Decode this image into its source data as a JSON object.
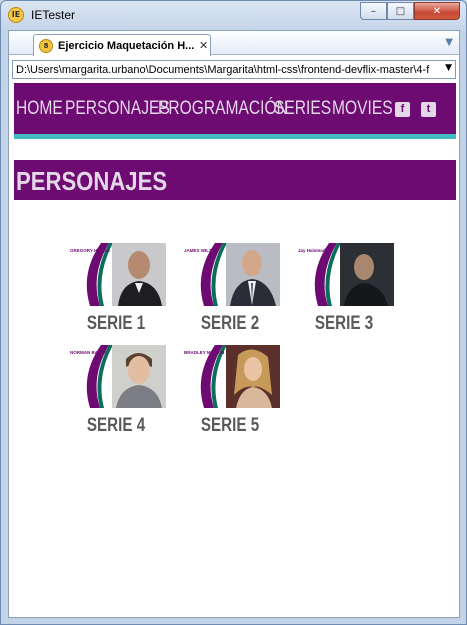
{
  "window": {
    "app_title": "IETester",
    "app_icon_text": "IE",
    "min_glyph": "–",
    "max_glyph": "□",
    "close_glyph": "✕"
  },
  "tab": {
    "icon_text": "8",
    "label": "Ejercicio Maquetación H...",
    "close_glyph": "✕",
    "menu_glyph": "▼"
  },
  "address": {
    "value": "D:\\Users\\margarita.urbano\\Documents\\Margarita\\html-css\\frontend-devflix-master\\4-f",
    "drop_glyph": "▼"
  },
  "nav": {
    "home": "HOME",
    "personajes": "PERSONAJES",
    "programacion": "PROGRAMACIÓN",
    "series": "SERIES",
    "movies": "MOVIES",
    "facebook_glyph": "f",
    "twitter_glyph": "t"
  },
  "section": {
    "title": "PERSONAJES"
  },
  "cards": [
    {
      "poster_label": "GREGORY HOUSE",
      "title": "SERIE 1"
    },
    {
      "poster_label": "JAMES WILSON",
      "title": "SERIE 2"
    },
    {
      "poster_label": "Jay Halstead",
      "title": "SERIE 3"
    },
    {
      "poster_label": "NORMAN BATES",
      "title": "SERIE 4"
    },
    {
      "poster_label": "BRADLEY MARTIN",
      "title": "SERIE 5"
    }
  ],
  "colors": {
    "nav_bg": "#6d0b72",
    "nav_text": "#e4d7e8",
    "accent_strip": "#43bcc1",
    "card_title": "#5a5a5a"
  }
}
